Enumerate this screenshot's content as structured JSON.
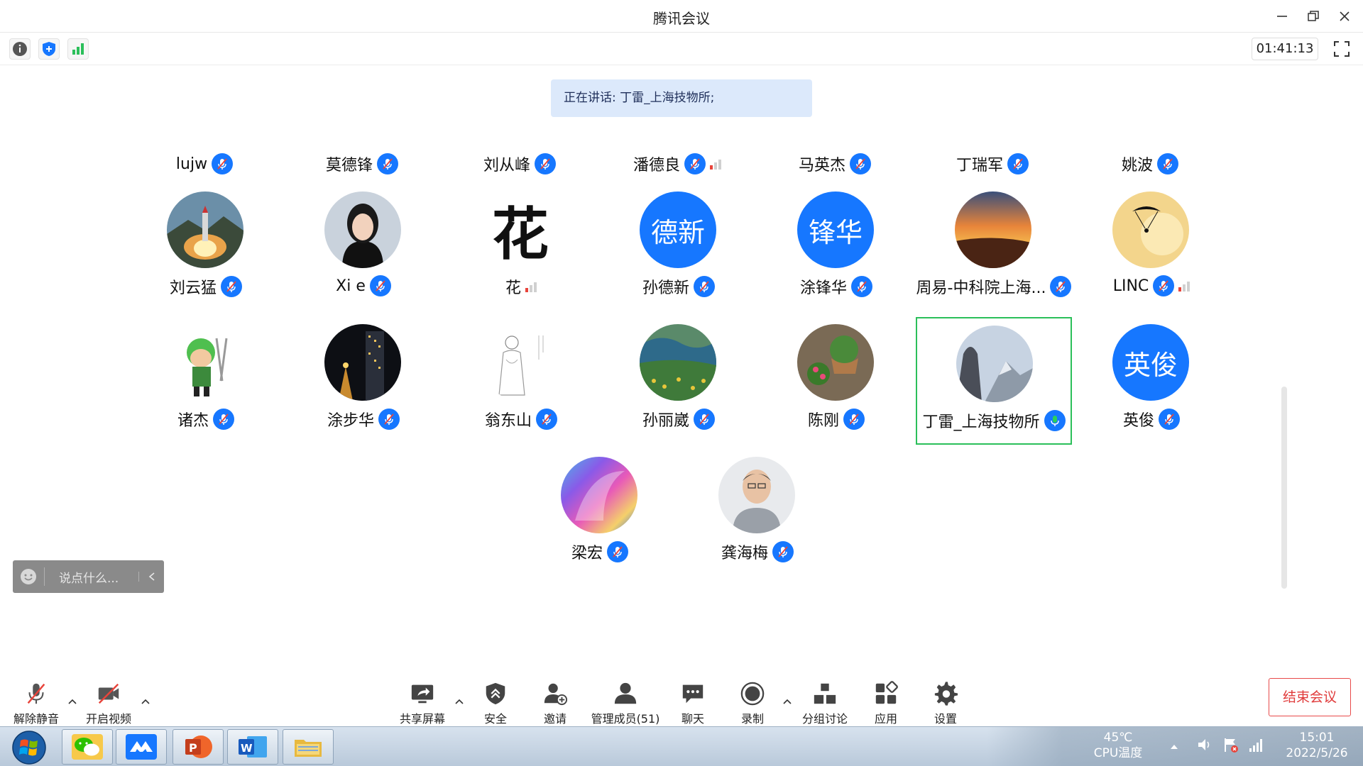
{
  "window": {
    "title": "腾讯会议"
  },
  "toolbar": {
    "timer": "01:41:13"
  },
  "speaking": {
    "text": "正在讲话: 丁雷_上海技物所;"
  },
  "top_row": [
    {
      "name": "lujw",
      "signal": false
    },
    {
      "name": "莫德锋",
      "signal": false
    },
    {
      "name": "刘从峰",
      "signal": false
    },
    {
      "name": "潘德良",
      "signal": true
    },
    {
      "name": "马英杰",
      "signal": false
    },
    {
      "name": "丁瑞军",
      "signal": false
    },
    {
      "name": "姚波",
      "signal": false
    }
  ],
  "participants": [
    {
      "name": "刘云猛",
      "avatar": "rocket-launch-photo",
      "signal": false,
      "active": false,
      "mic_on": false
    },
    {
      "name": "Xi e",
      "avatar": "woman-portrait-photo",
      "signal": false,
      "active": false,
      "mic_on": false
    },
    {
      "name": "花",
      "avatar": "calligraphy-character-image",
      "avatar_text": "花",
      "signal": true,
      "active": false,
      "mic_on": false
    },
    {
      "name": "孙德新",
      "avatar": "text-avatar",
      "avatar_text": "德新",
      "signal": false,
      "active": false,
      "mic_on": false
    },
    {
      "name": "涂锋华",
      "avatar": "text-avatar",
      "avatar_text": "锋华",
      "signal": false,
      "active": false,
      "mic_on": false
    },
    {
      "name": "周易-中科院上海...",
      "avatar": "sunset-photo",
      "signal": false,
      "active": false,
      "mic_on": false
    },
    {
      "name": "LINC",
      "avatar": "paraglider-photo",
      "signal": true,
      "active": false,
      "mic_on": false
    },
    {
      "name": "诸杰",
      "avatar": "cartoon-swordsman-image",
      "signal": false,
      "active": false,
      "mic_on": false
    },
    {
      "name": "涂步华",
      "avatar": "night-tower-photo",
      "signal": false,
      "active": false,
      "mic_on": false
    },
    {
      "name": "翁东山",
      "avatar": "ink-sketch-image",
      "signal": false,
      "active": false,
      "mic_on": false
    },
    {
      "name": "孙丽崴",
      "avatar": "landscape-painting-image",
      "signal": false,
      "active": false,
      "mic_on": false
    },
    {
      "name": "陈刚",
      "avatar": "potted-plant-photo",
      "signal": false,
      "active": false,
      "mic_on": false
    },
    {
      "name": "丁雷_上海技物所",
      "avatar": "mountain-photo",
      "signal": false,
      "active": true,
      "mic_on": true
    },
    {
      "name": "英俊",
      "avatar": "text-avatar",
      "avatar_text": "英俊",
      "signal": false,
      "active": false,
      "mic_on": false
    },
    {
      "name": "梁宏",
      "avatar": "holographic-swirl-image",
      "signal": false,
      "active": false,
      "mic_on": false
    },
    {
      "name": "龚海梅",
      "avatar": "man-portrait-photo",
      "signal": false,
      "active": false,
      "mic_on": false
    }
  ],
  "chat": {
    "placeholder": "说点什么..."
  },
  "bottom": {
    "unmute": "解除静音",
    "video": "开启视频",
    "share": "共享屏幕",
    "security": "安全",
    "invite": "邀请",
    "members": "管理成员(51)",
    "chat": "聊天",
    "record": "录制",
    "breakout": "分组讨论",
    "apps": "应用",
    "settings": "设置",
    "end": "结束会议"
  },
  "taskbar": {
    "temp": "45℃",
    "temp_label": "CPU温度",
    "time": "15:01",
    "date": "2022/5/26",
    "apps": [
      "wechat-icon",
      "tencent-meeting-icon",
      "powerpoint-icon",
      "word-icon",
      "file-explorer-icon"
    ]
  },
  "colors": {
    "accent": "#1677ff",
    "active_border": "#2bbf5a",
    "end_red": "#e03b3b",
    "banner": "#dce9fb"
  }
}
